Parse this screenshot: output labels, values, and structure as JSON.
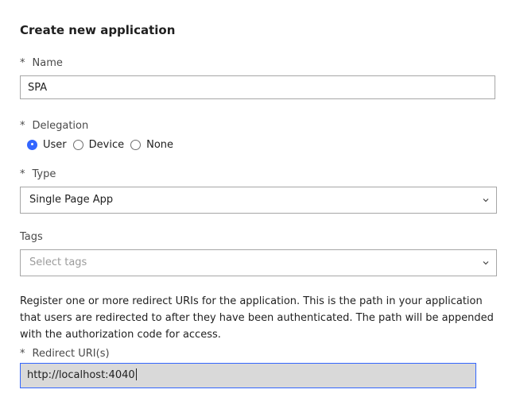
{
  "form": {
    "title": "Create new application",
    "required_marker": "*",
    "name": {
      "label": "Name",
      "value": "SPA"
    },
    "delegation": {
      "label": "Delegation",
      "options": [
        "User",
        "Device",
        "None"
      ],
      "selected": "User"
    },
    "type": {
      "label": "Type",
      "value": "Single Page App"
    },
    "tags": {
      "label": "Tags",
      "placeholder": "Select tags"
    },
    "redirect_help": "Register one or more redirect URIs for the application. This is the path in your application that users are redirected to after they have been authenticated. The path will be appended with the authorization code for access.",
    "redirect": {
      "label": "Redirect URI(s)",
      "value": "http://localhost:4040"
    }
  },
  "colors": {
    "accent": "#3366ff",
    "input_border": "#a6a6a6",
    "focused_input_bg": "#d9d9d9"
  },
  "icons": {
    "dropdown": "chevron-down-icon"
  }
}
